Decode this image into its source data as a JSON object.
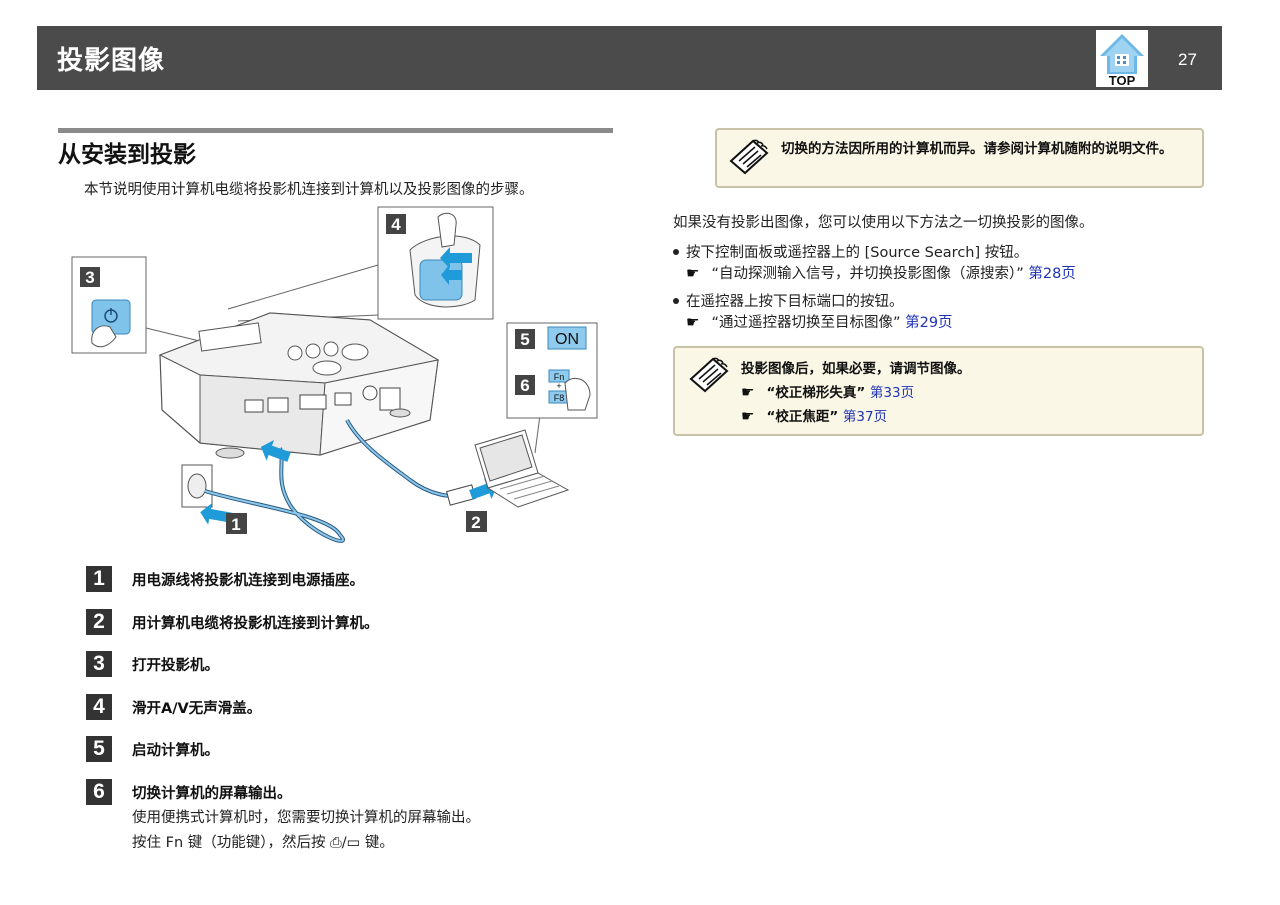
{
  "header": {
    "title": "投影图像",
    "page_number": "27",
    "top_label": "TOP"
  },
  "section": {
    "title": "从安装到投影",
    "intro": "本节说明使用计算机电缆将投影机连接到计算机以及投影图像的步骤。"
  },
  "figure": {
    "callouts": [
      "1",
      "2",
      "3",
      "4",
      "5",
      "6"
    ],
    "on_label": "ON",
    "fn_label": "Fn",
    "f8_label": "F8",
    "plus": "+"
  },
  "steps": [
    {
      "num": "1",
      "text": "用电源线将投影机连接到电源插座。"
    },
    {
      "num": "2",
      "text": "用计算机电缆将投影机连接到计算机。"
    },
    {
      "num": "3",
      "text": "打开投影机。"
    },
    {
      "num": "4",
      "text": "滑开A/V无声滑盖。"
    },
    {
      "num": "5",
      "text": "启动计算机。"
    },
    {
      "num": "6",
      "text": "切换计算机的屏幕输出。",
      "sub1": "使用便携式计算机时，您需要切换计算机的屏幕输出。",
      "sub2_a": "按住 Fn 键（功能键），然后按 ",
      "sub2_glyph": "⎙/▭",
      "sub2_b": " 键。"
    }
  ],
  "note1": {
    "text": "切换的方法因所用的计算机而异。请参阅计算机随附的说明文件。"
  },
  "right": {
    "para": "如果没有投影出图像，您可以使用以下方法之一切换投影的图像。",
    "bullets": [
      {
        "text": "按下控制面板或遥控器上的 [Source Search] 按钮。",
        "ref": "“自动探测输入信号，并切换投影图像（源搜索）”",
        "link": "第28页"
      },
      {
        "text": "在遥控器上按下目标端口的按钮。",
        "ref": "“通过遥控器切换至目标图像”",
        "link": "第29页"
      }
    ]
  },
  "note2": {
    "text": "投影图像后，如果必要，请调节图像。",
    "refs": [
      {
        "ref": "“校正梯形失真”",
        "link": "第33页"
      },
      {
        "ref": "“校正焦距”",
        "link": "第37页"
      }
    ]
  }
}
